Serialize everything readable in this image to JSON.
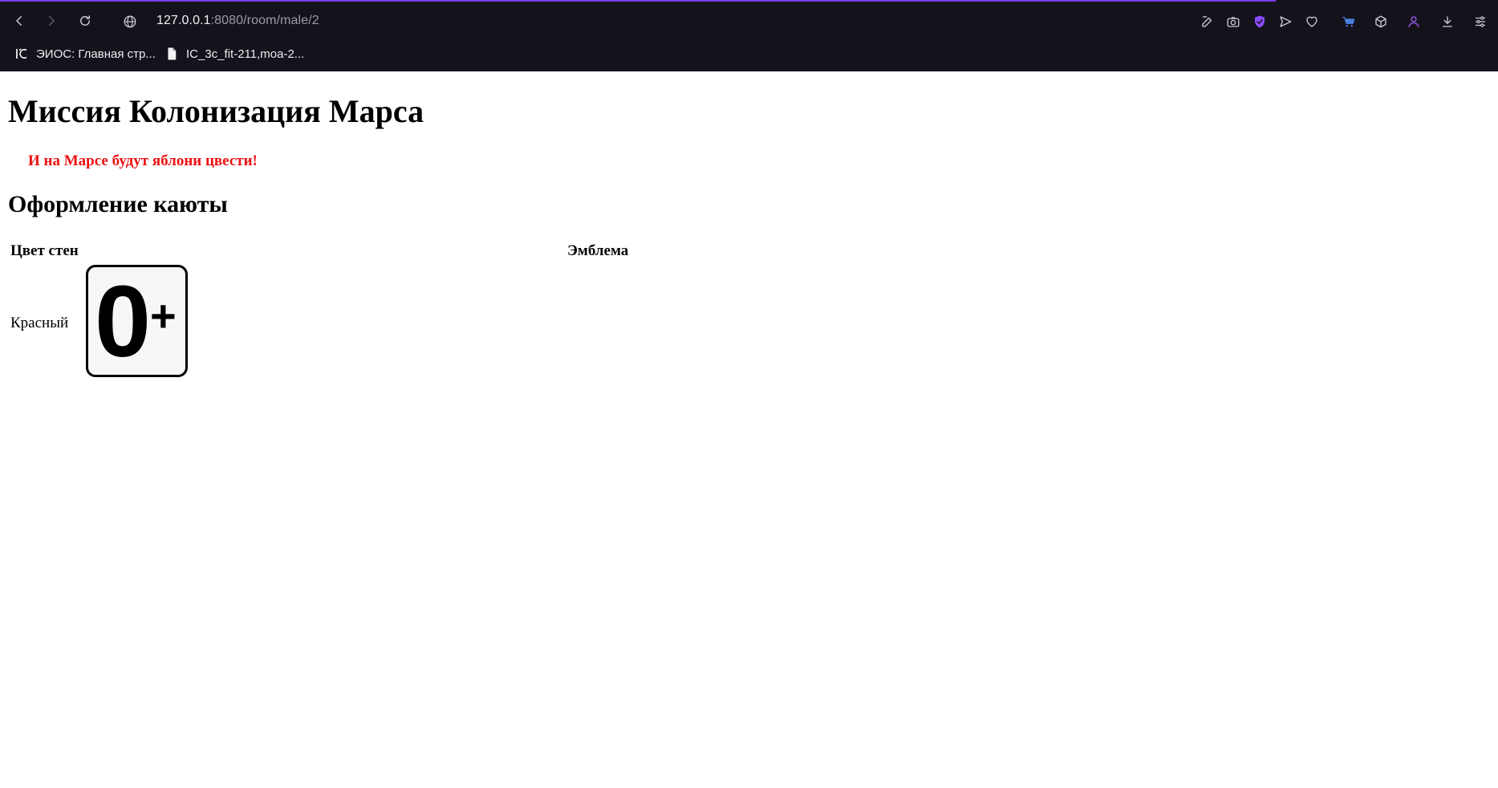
{
  "browser": {
    "url_host": "127.0.0.1",
    "url_path": ":8080/room/male/2",
    "toolbar_icons": [
      "edit-icon",
      "camera-icon",
      "shield-check-icon",
      "send-icon",
      "heart-icon",
      "cart-icon",
      "cube-icon",
      "user-icon",
      "download-icon",
      "settings-sliders-icon"
    ],
    "accent_color": "#7b3fe4"
  },
  "bookmarks": [
    {
      "label": "ЭИОС: Главная стр...",
      "icon": "1c-logo-icon"
    },
    {
      "label": "IC_3c_fit-211,moa-2...",
      "icon": "file-icon"
    }
  ],
  "page": {
    "title": "Миссия Колонизация Марса",
    "slogan": "И на Марсе будут яблони цвести!",
    "slogan_color": "#ee1111",
    "section_title": "Оформление каюты",
    "table": {
      "headers": [
        "Цвет стен",
        "Эмблема"
      ],
      "wall_color": "Красный",
      "emblem": {
        "main": "0",
        "sup": "+"
      }
    }
  }
}
